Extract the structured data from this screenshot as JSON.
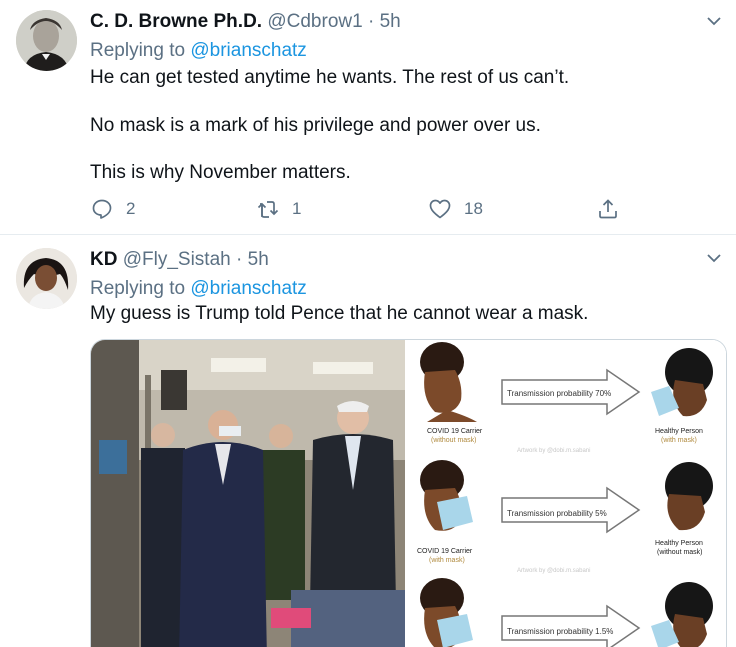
{
  "tweets": [
    {
      "name": "C. D. Browne Ph.D.",
      "handle": "@Cdbrow1",
      "time": "5h",
      "replying_prefix": "Replying to",
      "replying_to": "@brianschatz",
      "lines": [
        "He can get tested anytime he wants.  The rest of us can’t.",
        "No mask is a mark of his privilege and power over us.",
        "This is why November matters."
      ],
      "replies": "2",
      "retweets": "1",
      "likes": "18"
    },
    {
      "name": "KD",
      "handle": "@Fly_Sistah",
      "time": "5h",
      "replying_prefix": "Replying to",
      "replying_to": "@brianschatz",
      "text": "My guess is Trump told Pence that he cannot wear a mask.",
      "infographic": {
        "row1_label": "Transmission probability 70%",
        "row2_label": "Transmission probability 5%",
        "row3_label": "Transmission probability 1.5%",
        "carrier_no_mask": [
          "COVID 19 Carrier",
          "(without mask)"
        ],
        "carrier_mask": [
          "COVID 19 Carrier",
          "(with mask)"
        ],
        "healthy_mask": [
          "Healthy Person",
          "(with mask)"
        ],
        "healthy_no_mask": [
          "Healthy Person",
          "(without mask)"
        ],
        "credit": "Artwork by @dobi.m.sabani"
      }
    }
  ],
  "colors": {
    "link": "#1b95e0",
    "muted": "#5b7083",
    "text": "#0f1419",
    "divider": "#e6ecf0"
  },
  "icons": [
    "chevron-down-icon",
    "reply-icon",
    "retweet-icon",
    "like-icon",
    "share-icon"
  ]
}
